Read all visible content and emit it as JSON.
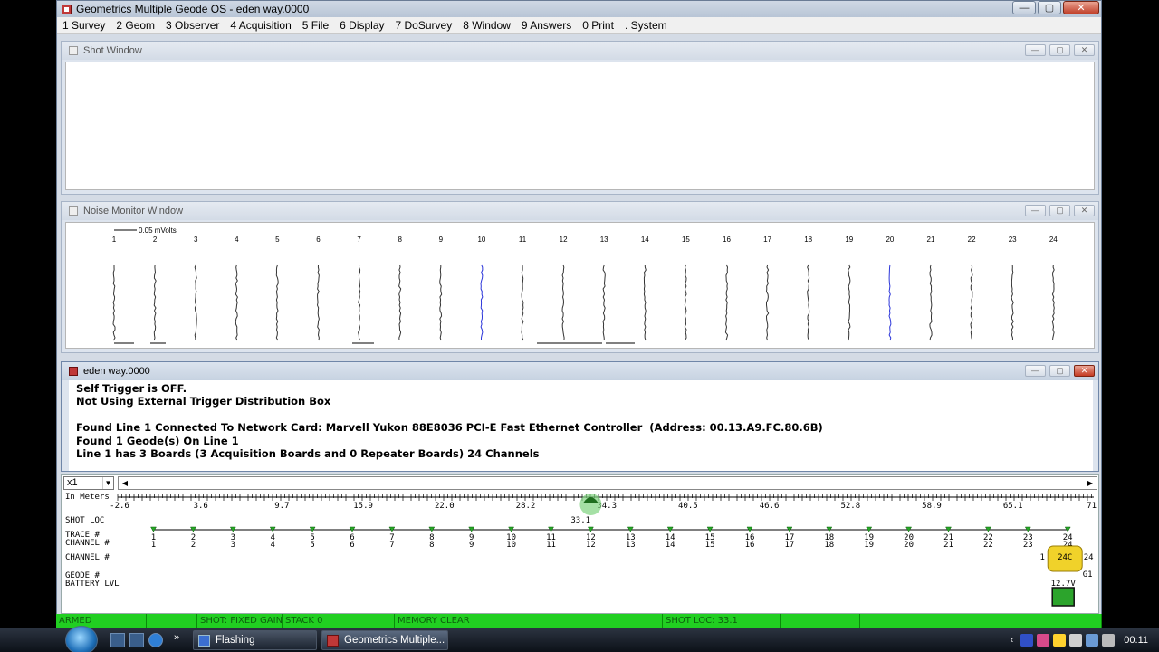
{
  "window": {
    "title": "Geometrics Multiple Geode OS - eden way.0000",
    "min": "—",
    "max": "▢",
    "close": "✕"
  },
  "menu": [
    "1 Survey",
    "2 Geom",
    "3 Observer",
    "4 Acquisition",
    "5 File",
    "6 Display",
    "7 DoSurvey",
    "8 Window",
    "9 Answers",
    "0 Print",
    ". System"
  ],
  "shot_window": {
    "title": "Shot Window"
  },
  "noise_window": {
    "title": "Noise Monitor Window",
    "scale_label": "0.05 mVolts",
    "channels": [
      "1",
      "2",
      "3",
      "4",
      "5",
      "6",
      "7",
      "8",
      "9",
      "10",
      "11",
      "12",
      "13",
      "14",
      "15",
      "16",
      "17",
      "18",
      "19",
      "20",
      "21",
      "22",
      "23",
      "24"
    ],
    "highlight_channels": [
      "10",
      "20"
    ]
  },
  "log_window": {
    "title": "eden way.0000",
    "lines": [
      "Self Trigger is OFF.",
      "Not Using External Trigger Distribution Box",
      "",
      "Found Line 1 Connected To Network Card: Marvell Yukon 88E8036 PCI-E Fast Ethernet Controller  (Address: 00.13.A9.FC.80.6B)",
      "Found 1 Geode(s) On Line 1",
      "Line 1 has 3 Boards (3 Acquisition Boards and 0 Repeater Boards) 24 Channels"
    ]
  },
  "survey": {
    "zoom": "x1",
    "units_label": "In Meters",
    "ruler_ticks": [
      "-2.6",
      "3.6",
      "9.7",
      "15.9",
      "22.0",
      "28.2",
      "34.3",
      "40.5",
      "46.6",
      "52.8",
      "58.9",
      "65.1",
      "71."
    ],
    "row_labels": {
      "shot_loc": "SHOT LOC",
      "trace": "TRACE #",
      "channel_a": "CHANNEL #",
      "channel_b": "CHANNEL #",
      "geode": "GEODE #",
      "battery": "BATTERY LVL"
    },
    "shot_value": "33.1",
    "traces": [
      "1",
      "2",
      "3",
      "4",
      "5",
      "6",
      "7",
      "8",
      "9",
      "10",
      "11",
      "12",
      "13",
      "14",
      "15",
      "16",
      "17",
      "18",
      "19",
      "20",
      "21",
      "22",
      "23",
      "24"
    ],
    "blue_traces": [
      "8",
      "16"
    ],
    "red_traces": [
      "1",
      "24"
    ],
    "geode": {
      "label": "24C",
      "left_num": "1",
      "right_num": "24",
      "id": "G1",
      "voltage": "12.7V"
    }
  },
  "status": {
    "cells": [
      "ARMED",
      "",
      "SHOT: FIXED GAIN",
      "STACK 0",
      "MEMORY CLEAR",
      "SHOT LOC: 33.1",
      "",
      ""
    ]
  },
  "taskbar": {
    "tasks": [
      "Flashing",
      "Geometrics Multiple..."
    ],
    "clock": "00:11",
    "chevron": "»",
    "tray_arrow": "‹"
  },
  "colors": {
    "status_green": "#21cf21",
    "noise_highlight": "#2b35d9",
    "trace_blue": "#1a3fbf",
    "trace_red": "#cc1111",
    "geophone_green": "#27a827"
  }
}
